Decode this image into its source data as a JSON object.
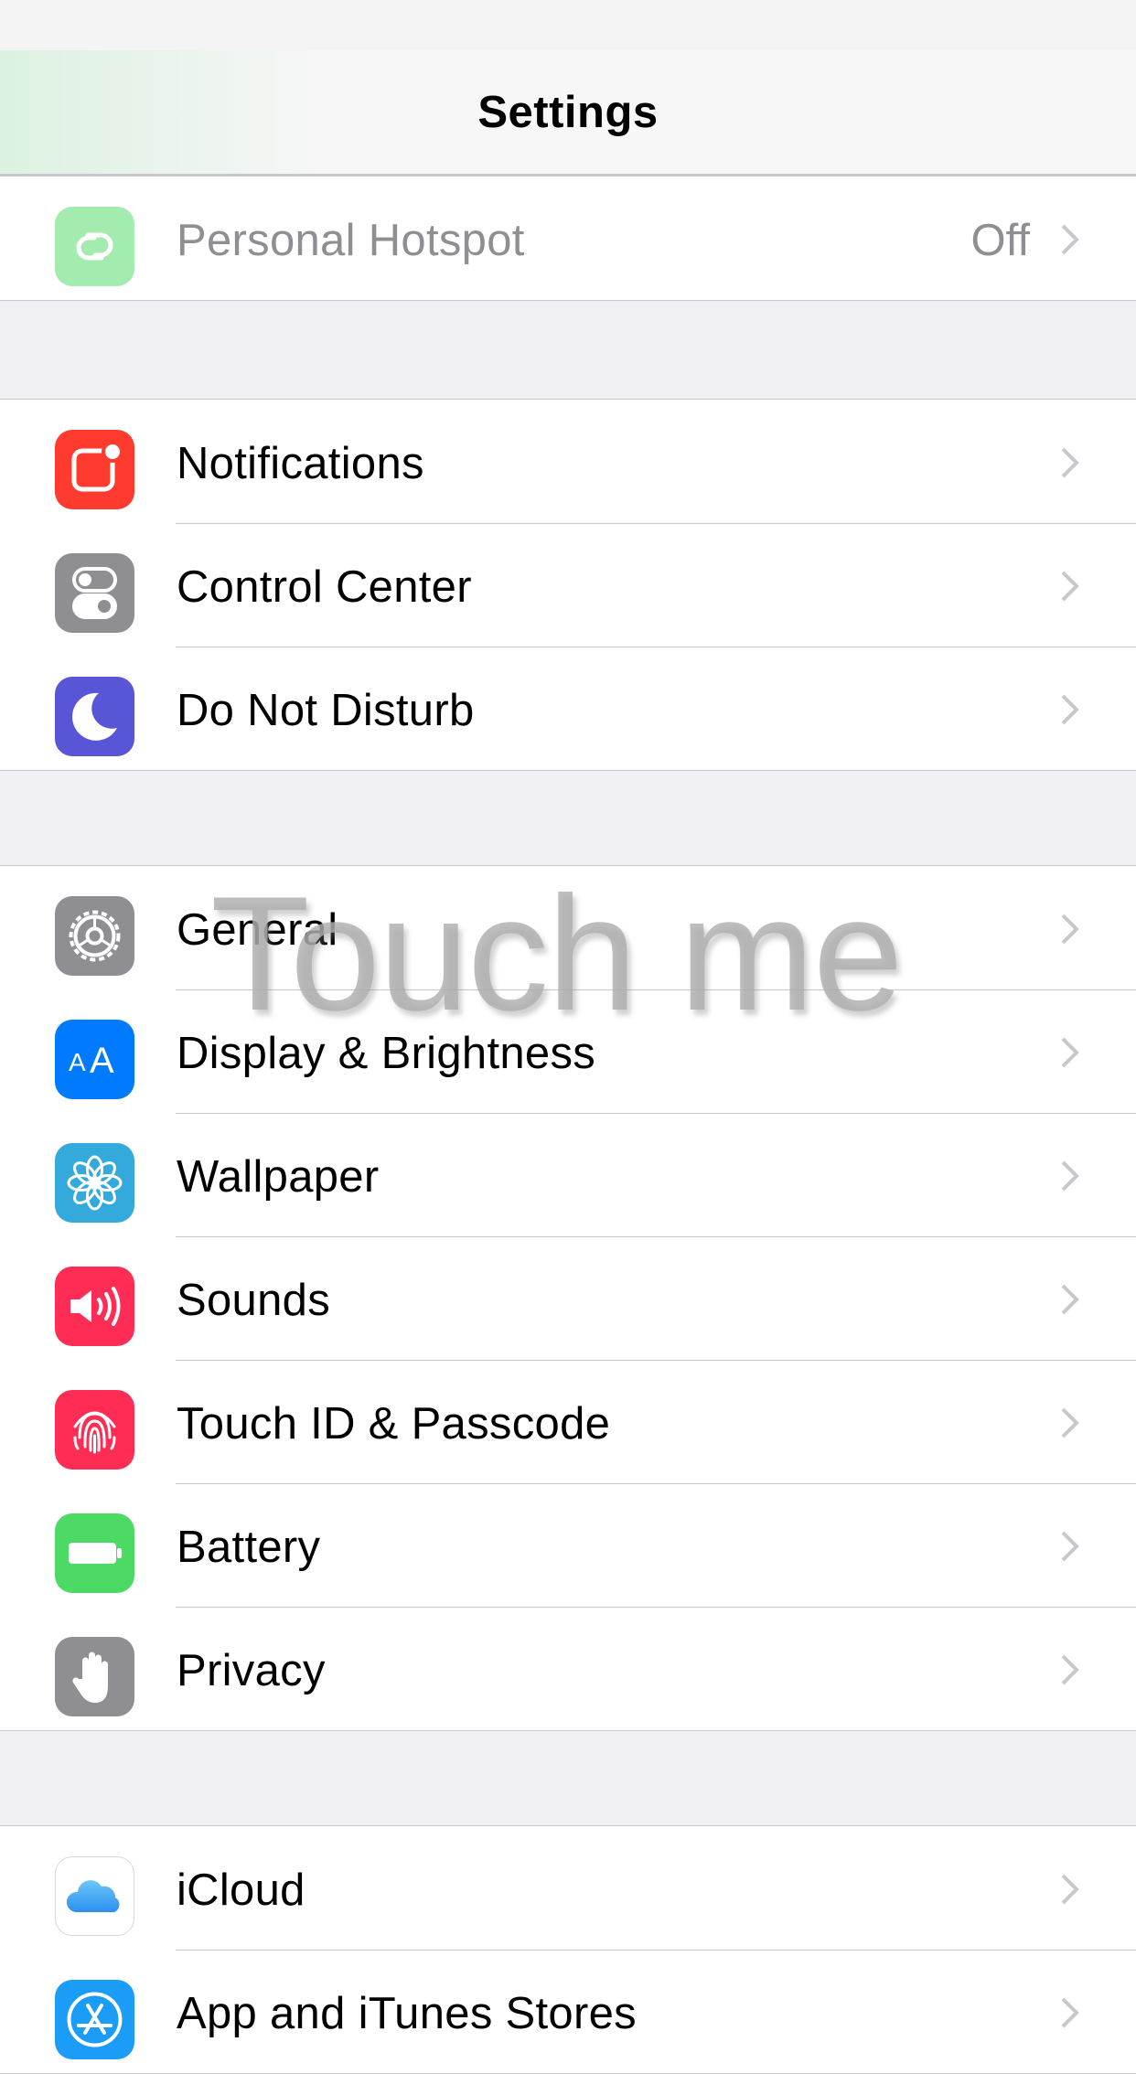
{
  "navbar": {
    "title": "Settings"
  },
  "groups": [
    {
      "rows": [
        {
          "label": "Personal Hotspot",
          "value": "Off",
          "icon": "hotspot-icon",
          "color": "#4cd964"
        }
      ]
    },
    {
      "rows": [
        {
          "label": "Notifications",
          "icon": "notifications-icon",
          "color": "#ff3b30"
        },
        {
          "label": "Control Center",
          "icon": "control-center-icon",
          "color": "#8e8e93"
        },
        {
          "label": "Do Not Disturb",
          "icon": "moon-icon",
          "color": "#5856d6"
        }
      ]
    },
    {
      "rows": [
        {
          "label": "General",
          "icon": "gear-icon",
          "color": "#8e8e93"
        },
        {
          "label": "Display & Brightness",
          "icon": "display-icon",
          "color": "#007aff"
        },
        {
          "label": "Wallpaper",
          "icon": "flower-icon",
          "color": "#34aadc"
        },
        {
          "label": "Sounds",
          "icon": "speaker-icon",
          "color": "#ff2d55"
        },
        {
          "label": "Touch ID & Passcode",
          "icon": "fingerprint-icon",
          "color": "#ff2d55"
        },
        {
          "label": "Battery",
          "icon": "battery-icon",
          "color": "#4cd964"
        },
        {
          "label": "Privacy",
          "icon": "hand-icon",
          "color": "#8e8e93"
        }
      ]
    },
    {
      "rows": [
        {
          "label": "iCloud",
          "icon": "cloud-icon",
          "color": "#ffffff"
        },
        {
          "label": "App and iTunes Stores",
          "icon": "app-store-icon",
          "color": "#1a9cf7"
        }
      ]
    }
  ],
  "overlay": {
    "text": "Touch me"
  }
}
